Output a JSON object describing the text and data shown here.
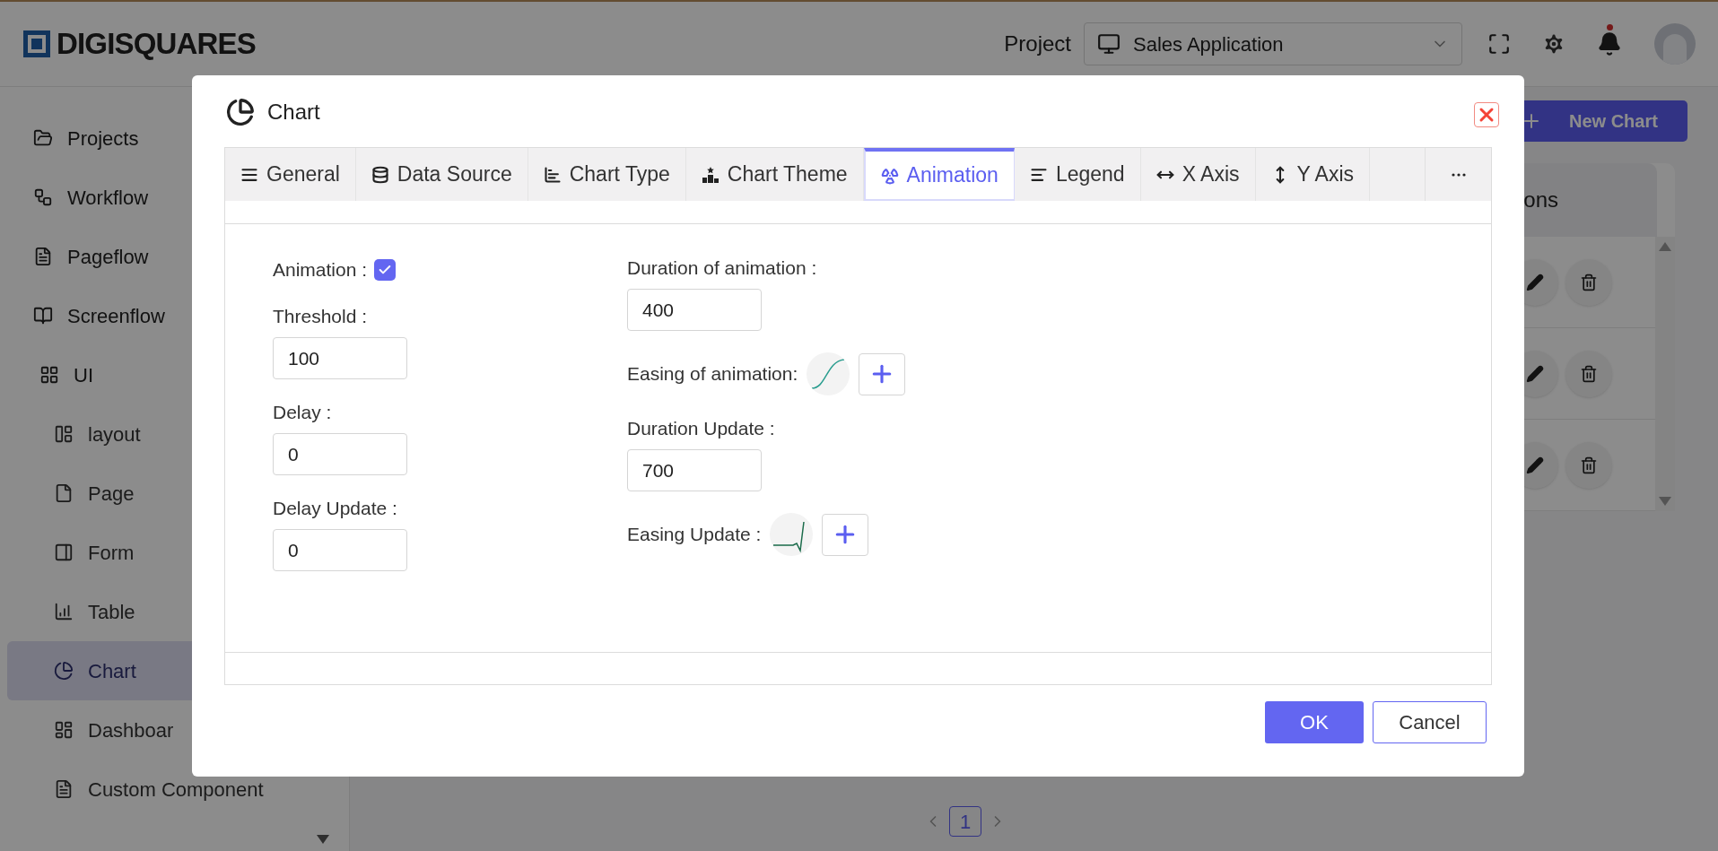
{
  "header": {
    "logo": "DIGISQUARES",
    "project_label": "Project",
    "project_select": "Sales Application"
  },
  "sidebar": {
    "items": [
      {
        "label": "Projects",
        "selected": false
      },
      {
        "label": "Workflow",
        "selected": false
      },
      {
        "label": "Pageflow",
        "selected": false
      },
      {
        "label": "Screenflow",
        "selected": false
      },
      {
        "label": "UI",
        "selected": false,
        "children": [
          {
            "label": "layout",
            "selected": false
          },
          {
            "label": "Page",
            "selected": false
          },
          {
            "label": "Form",
            "selected": false
          },
          {
            "label": "Table",
            "selected": false
          },
          {
            "label": "Chart",
            "selected": true
          },
          {
            "label": "Dashboar",
            "selected": false
          },
          {
            "label": "Custom Component",
            "selected": false
          }
        ]
      }
    ]
  },
  "main": {
    "new_chart_button": "New Chart",
    "table": {
      "header": "ons",
      "rows": [
        {
          "kind": "actions"
        },
        {
          "kind": "actions"
        },
        {
          "kind": "actions"
        }
      ]
    },
    "pagination": [
      {
        "label": "1",
        "selected": true
      }
    ]
  },
  "dialog": {
    "title": "Chart",
    "tabs": [
      {
        "label": "General",
        "selected": false
      },
      {
        "label": "Data Source",
        "selected": false
      },
      {
        "label": "Chart Type",
        "selected": false
      },
      {
        "label": "Chart Theme",
        "selected": false
      },
      {
        "label": "Animation",
        "selected": true
      },
      {
        "label": "Legend",
        "selected": false
      },
      {
        "label": "X Axis",
        "selected": false
      },
      {
        "label": "Y Axis",
        "selected": false
      }
    ],
    "left_fields": [
      {
        "kind": "checkbox",
        "label": "Animation :",
        "checked": true
      },
      {
        "kind": "input",
        "label": "Threshold :",
        "value": "100"
      },
      {
        "kind": "input",
        "label": "Delay :",
        "value": "0"
      },
      {
        "kind": "input",
        "label": "Delay Update :",
        "value": "0"
      }
    ],
    "right_fields": [
      {
        "kind": "input",
        "label": "Duration of animation :",
        "value": "400"
      },
      {
        "kind": "easing",
        "label": "Easing of animation:"
      },
      {
        "kind": "input",
        "label": "Duration Update :",
        "value": "700"
      },
      {
        "kind": "easing",
        "label": "Easing Update :"
      }
    ],
    "buttons": {
      "ok": "OK",
      "cancel": "Cancel"
    }
  }
}
